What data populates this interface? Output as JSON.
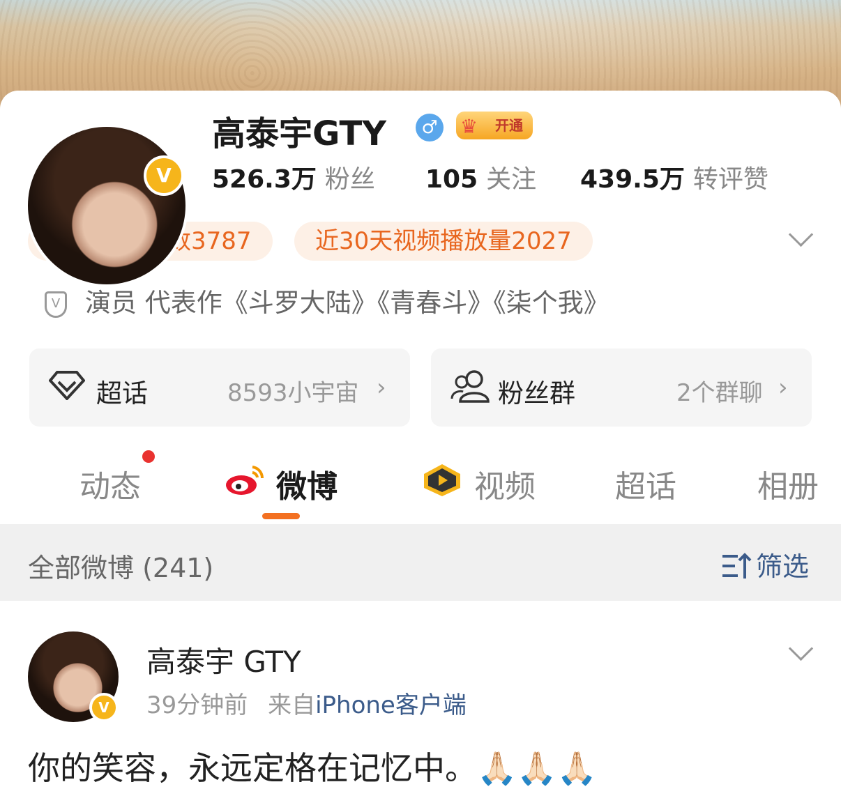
{
  "profile": {
    "name": "高泰宇GTY",
    "gender_symbol": "♂",
    "vip_label": "开通",
    "verified_badge": "V",
    "stats": [
      {
        "value": "526.3万",
        "label": "粉丝"
      },
      {
        "value": "105",
        "label": "关注"
      },
      {
        "value": "439.5万",
        "label": "转评赞"
      }
    ],
    "tags": [
      "本月互动人数3787",
      "近30天视频播放量2027"
    ],
    "bio": "演员 代表作《斗罗大陆》《青春斗》《柒个我》",
    "bio_icon": "V"
  },
  "cards": [
    {
      "icon": "diamond-icon",
      "title": "超话",
      "meta": "8593小宇宙",
      "chevron": "›"
    },
    {
      "icon": "group-icon",
      "title": "粉丝群",
      "meta": "2个群聊",
      "chevron": "›"
    }
  ],
  "tabs": [
    "动态",
    "微博",
    "视频",
    "超话",
    "相册"
  ],
  "active_tab": "微博",
  "filter": {
    "all_label": "全部微博 (241)",
    "filter_label": "筛选"
  },
  "post": {
    "author": "高泰宇 GTY",
    "time": "39分钟前",
    "source_prefix": "来自",
    "source": "iPhone客户端",
    "text": "你的笑容，永远定格在记忆中。🙏🏻🙏🏻🙏🏻"
  },
  "colors": {
    "accent": "#f37021",
    "tag_text": "#e8661f",
    "vip_gold": "#f6b51b",
    "link_blue": "#3b5b8a"
  }
}
